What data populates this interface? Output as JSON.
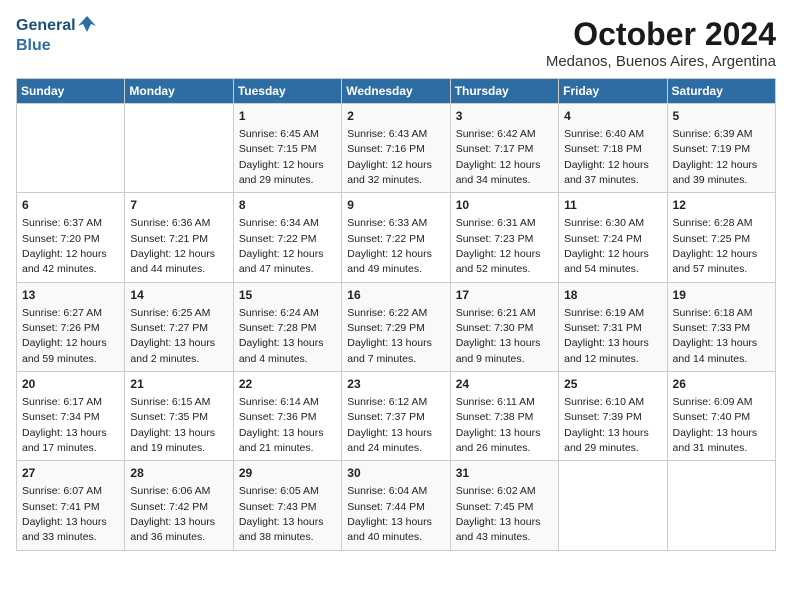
{
  "logo": {
    "line1": "General",
    "line2": "Blue"
  },
  "title": "October 2024",
  "subtitle": "Medanos, Buenos Aires, Argentina",
  "headers": [
    "Sunday",
    "Monday",
    "Tuesday",
    "Wednesday",
    "Thursday",
    "Friday",
    "Saturday"
  ],
  "weeks": [
    [
      {
        "day": "",
        "sunrise": "",
        "sunset": "",
        "daylight": ""
      },
      {
        "day": "",
        "sunrise": "",
        "sunset": "",
        "daylight": ""
      },
      {
        "day": "1",
        "sunrise": "Sunrise: 6:45 AM",
        "sunset": "Sunset: 7:15 PM",
        "daylight": "Daylight: 12 hours and 29 minutes."
      },
      {
        "day": "2",
        "sunrise": "Sunrise: 6:43 AM",
        "sunset": "Sunset: 7:16 PM",
        "daylight": "Daylight: 12 hours and 32 minutes."
      },
      {
        "day": "3",
        "sunrise": "Sunrise: 6:42 AM",
        "sunset": "Sunset: 7:17 PM",
        "daylight": "Daylight: 12 hours and 34 minutes."
      },
      {
        "day": "4",
        "sunrise": "Sunrise: 6:40 AM",
        "sunset": "Sunset: 7:18 PM",
        "daylight": "Daylight: 12 hours and 37 minutes."
      },
      {
        "day": "5",
        "sunrise": "Sunrise: 6:39 AM",
        "sunset": "Sunset: 7:19 PM",
        "daylight": "Daylight: 12 hours and 39 minutes."
      }
    ],
    [
      {
        "day": "6",
        "sunrise": "Sunrise: 6:37 AM",
        "sunset": "Sunset: 7:20 PM",
        "daylight": "Daylight: 12 hours and 42 minutes."
      },
      {
        "day": "7",
        "sunrise": "Sunrise: 6:36 AM",
        "sunset": "Sunset: 7:21 PM",
        "daylight": "Daylight: 12 hours and 44 minutes."
      },
      {
        "day": "8",
        "sunrise": "Sunrise: 6:34 AM",
        "sunset": "Sunset: 7:22 PM",
        "daylight": "Daylight: 12 hours and 47 minutes."
      },
      {
        "day": "9",
        "sunrise": "Sunrise: 6:33 AM",
        "sunset": "Sunset: 7:22 PM",
        "daylight": "Daylight: 12 hours and 49 minutes."
      },
      {
        "day": "10",
        "sunrise": "Sunrise: 6:31 AM",
        "sunset": "Sunset: 7:23 PM",
        "daylight": "Daylight: 12 hours and 52 minutes."
      },
      {
        "day": "11",
        "sunrise": "Sunrise: 6:30 AM",
        "sunset": "Sunset: 7:24 PM",
        "daylight": "Daylight: 12 hours and 54 minutes."
      },
      {
        "day": "12",
        "sunrise": "Sunrise: 6:28 AM",
        "sunset": "Sunset: 7:25 PM",
        "daylight": "Daylight: 12 hours and 57 minutes."
      }
    ],
    [
      {
        "day": "13",
        "sunrise": "Sunrise: 6:27 AM",
        "sunset": "Sunset: 7:26 PM",
        "daylight": "Daylight: 12 hours and 59 minutes."
      },
      {
        "day": "14",
        "sunrise": "Sunrise: 6:25 AM",
        "sunset": "Sunset: 7:27 PM",
        "daylight": "Daylight: 13 hours and 2 minutes."
      },
      {
        "day": "15",
        "sunrise": "Sunrise: 6:24 AM",
        "sunset": "Sunset: 7:28 PM",
        "daylight": "Daylight: 13 hours and 4 minutes."
      },
      {
        "day": "16",
        "sunrise": "Sunrise: 6:22 AM",
        "sunset": "Sunset: 7:29 PM",
        "daylight": "Daylight: 13 hours and 7 minutes."
      },
      {
        "day": "17",
        "sunrise": "Sunrise: 6:21 AM",
        "sunset": "Sunset: 7:30 PM",
        "daylight": "Daylight: 13 hours and 9 minutes."
      },
      {
        "day": "18",
        "sunrise": "Sunrise: 6:19 AM",
        "sunset": "Sunset: 7:31 PM",
        "daylight": "Daylight: 13 hours and 12 minutes."
      },
      {
        "day": "19",
        "sunrise": "Sunrise: 6:18 AM",
        "sunset": "Sunset: 7:33 PM",
        "daylight": "Daylight: 13 hours and 14 minutes."
      }
    ],
    [
      {
        "day": "20",
        "sunrise": "Sunrise: 6:17 AM",
        "sunset": "Sunset: 7:34 PM",
        "daylight": "Daylight: 13 hours and 17 minutes."
      },
      {
        "day": "21",
        "sunrise": "Sunrise: 6:15 AM",
        "sunset": "Sunset: 7:35 PM",
        "daylight": "Daylight: 13 hours and 19 minutes."
      },
      {
        "day": "22",
        "sunrise": "Sunrise: 6:14 AM",
        "sunset": "Sunset: 7:36 PM",
        "daylight": "Daylight: 13 hours and 21 minutes."
      },
      {
        "day": "23",
        "sunrise": "Sunrise: 6:12 AM",
        "sunset": "Sunset: 7:37 PM",
        "daylight": "Daylight: 13 hours and 24 minutes."
      },
      {
        "day": "24",
        "sunrise": "Sunrise: 6:11 AM",
        "sunset": "Sunset: 7:38 PM",
        "daylight": "Daylight: 13 hours and 26 minutes."
      },
      {
        "day": "25",
        "sunrise": "Sunrise: 6:10 AM",
        "sunset": "Sunset: 7:39 PM",
        "daylight": "Daylight: 13 hours and 29 minutes."
      },
      {
        "day": "26",
        "sunrise": "Sunrise: 6:09 AM",
        "sunset": "Sunset: 7:40 PM",
        "daylight": "Daylight: 13 hours and 31 minutes."
      }
    ],
    [
      {
        "day": "27",
        "sunrise": "Sunrise: 6:07 AM",
        "sunset": "Sunset: 7:41 PM",
        "daylight": "Daylight: 13 hours and 33 minutes."
      },
      {
        "day": "28",
        "sunrise": "Sunrise: 6:06 AM",
        "sunset": "Sunset: 7:42 PM",
        "daylight": "Daylight: 13 hours and 36 minutes."
      },
      {
        "day": "29",
        "sunrise": "Sunrise: 6:05 AM",
        "sunset": "Sunset: 7:43 PM",
        "daylight": "Daylight: 13 hours and 38 minutes."
      },
      {
        "day": "30",
        "sunrise": "Sunrise: 6:04 AM",
        "sunset": "Sunset: 7:44 PM",
        "daylight": "Daylight: 13 hours and 40 minutes."
      },
      {
        "day": "31",
        "sunrise": "Sunrise: 6:02 AM",
        "sunset": "Sunset: 7:45 PM",
        "daylight": "Daylight: 13 hours and 43 minutes."
      },
      {
        "day": "",
        "sunrise": "",
        "sunset": "",
        "daylight": ""
      },
      {
        "day": "",
        "sunrise": "",
        "sunset": "",
        "daylight": ""
      }
    ]
  ]
}
